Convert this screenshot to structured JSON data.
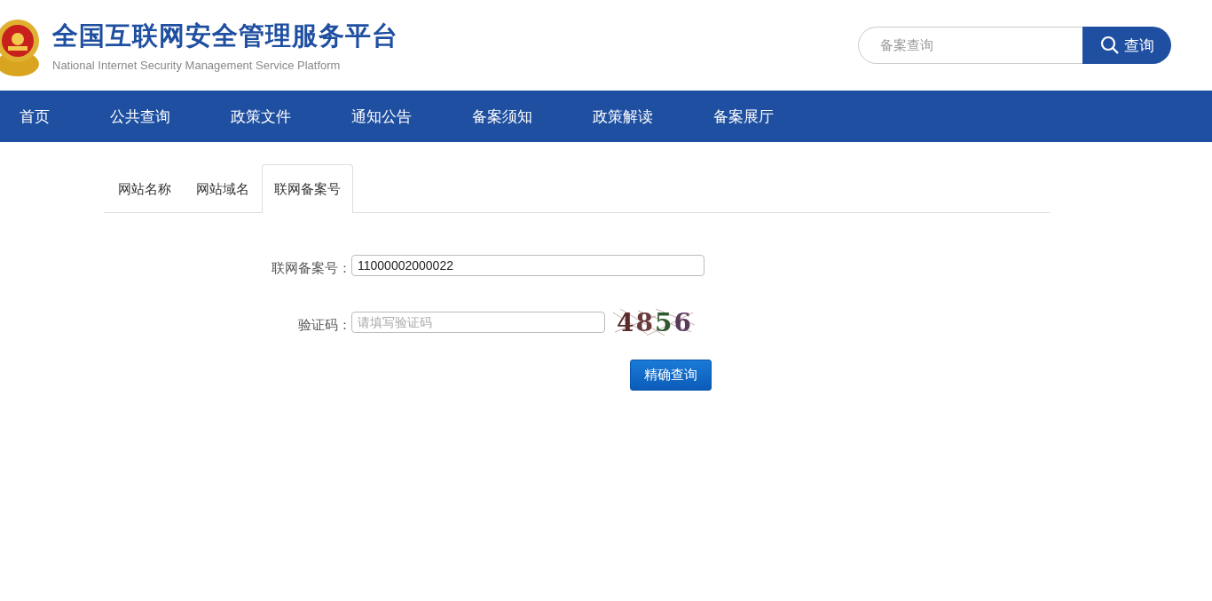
{
  "header": {
    "title": "全国互联网安全管理服务平台",
    "subtitle": "National Internet Security Management Service Platform",
    "search": {
      "placeholder": "备案查询",
      "button": "查询"
    }
  },
  "nav": [
    {
      "label": "首页"
    },
    {
      "label": "公共查询"
    },
    {
      "label": "政策文件"
    },
    {
      "label": "通知公告"
    },
    {
      "label": "备案须知"
    },
    {
      "label": "政策解读"
    },
    {
      "label": "备案展厅"
    }
  ],
  "tabs": [
    {
      "label": "网站名称",
      "selected": false
    },
    {
      "label": "网站域名",
      "selected": false
    },
    {
      "label": "联网备案号",
      "selected": true
    }
  ],
  "form": {
    "record_label": "联网备案号：",
    "record_value": "11000002000022",
    "captcha_label": "验证码：",
    "captcha_placeholder": "请填写验证码",
    "captcha": "4856",
    "submit": "精确查询"
  }
}
